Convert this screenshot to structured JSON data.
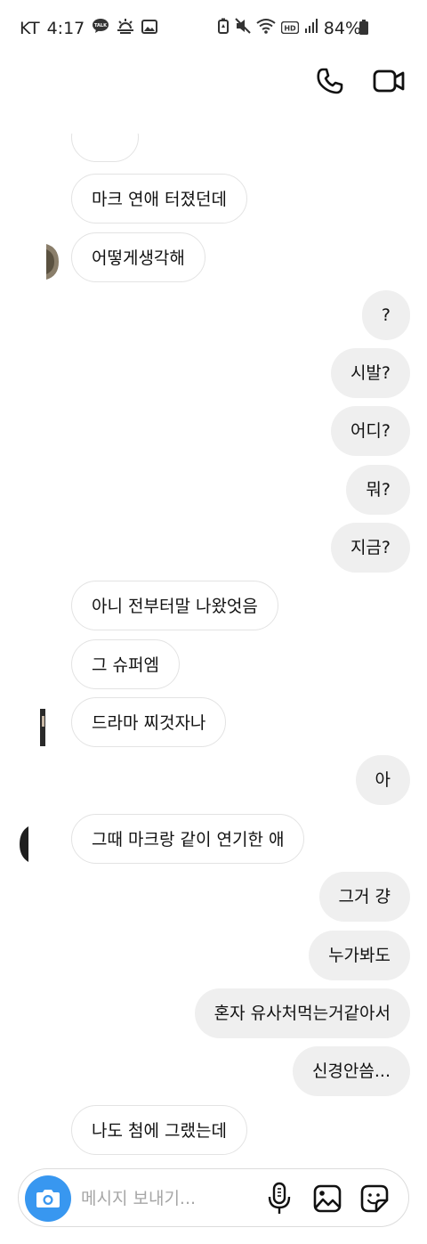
{
  "status_bar": {
    "carrier": "KT",
    "time": "4:17",
    "battery": "84%",
    "icons_left": [
      "kakaotalk-icon",
      "weather-icon",
      "image-icon"
    ],
    "icons_right": [
      "battery-saver-icon",
      "mute-icon",
      "wifi-icon",
      "hd-icon",
      "signal-icon",
      "battery-icon"
    ]
  },
  "header": {
    "contact_name": "",
    "actions": [
      "phone-icon",
      "video-icon"
    ]
  },
  "messages": [
    {
      "side": "in",
      "text": "마크 연애 터졌던데"
    },
    {
      "side": "in",
      "text": "어떻게생각해"
    },
    {
      "side": "out",
      "text": "?"
    },
    {
      "side": "out",
      "text": "시발?"
    },
    {
      "side": "out",
      "text": "어디?"
    },
    {
      "side": "out",
      "text": "뭐?"
    },
    {
      "side": "out",
      "text": "지금?"
    },
    {
      "side": "in",
      "text": "아니 전부터말 나왔엇음"
    },
    {
      "side": "in",
      "text": "그 슈퍼엠"
    },
    {
      "side": "in",
      "text": "드라마 찌것자나"
    },
    {
      "side": "out",
      "text": "아"
    },
    {
      "side": "in",
      "text": "그때 마크랑 같이 연기한 애"
    },
    {
      "side": "out",
      "text": "그거 걍"
    },
    {
      "side": "out",
      "text": "누가봐도"
    },
    {
      "side": "out",
      "text": "혼자 유사처먹는거같아서"
    },
    {
      "side": "out",
      "text": "신경안씀..."
    },
    {
      "side": "in",
      "text": "나도 첨에 그랬는데"
    }
  ],
  "composer": {
    "placeholder": "메시지 보내기...",
    "value": "",
    "accent": "#3897f0"
  },
  "colors": {
    "incoming_bubble_bg": "#ffffff",
    "incoming_bubble_border": "#e3e3e3",
    "outgoing_bubble_bg": "#efefef"
  }
}
